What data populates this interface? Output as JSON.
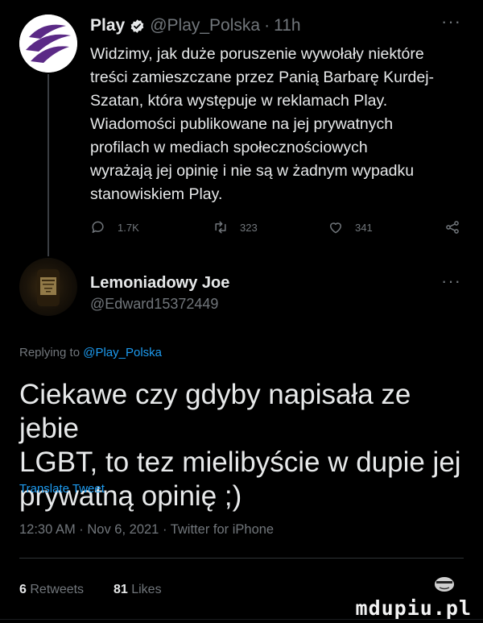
{
  "tweet1": {
    "author_name": "Play",
    "handle": "@Play_Polska",
    "separator": "·",
    "time_ago": "11h",
    "more": "···",
    "text_lines": [
      "Widzimy, jak duże poruszenie wywołały niektóre",
      "treści zamieszczane przez Panią Barbarę Kurdej-",
      "Szatan, która występuje w reklamach Play.",
      "Wiadomości publikowane na jej prywatnych",
      "profilach w mediach społecznościowych",
      "wyrażają jej opinię i nie są w żadnym wypadku",
      "stanowiskiem Play."
    ],
    "replies": "1.7K",
    "retweets": "323",
    "likes": "341",
    "icons": {
      "avatar": "play-logo-icon",
      "verified": "verified-badge-icon",
      "reply": "reply-icon",
      "retweet": "retweet-icon",
      "like": "heart-icon",
      "share": "share-icon"
    },
    "colors": {
      "brand_purple": "#5b2a86",
      "verified_blue": "#1d9bf0"
    }
  },
  "tweet2": {
    "author_name": "Lemoniadowy Joe",
    "handle": "@Edward15372449",
    "more": "···",
    "replying_prefix": "Replying to",
    "replying_to": "@Play_Polska",
    "text_lines": [
      "Ciekawe czy gdyby napisała ze jebie",
      "LGBT, to tez mielibyście w dupie jej",
      "prywatną opinię ;)"
    ],
    "translate": "Translate Tweet",
    "meta": "12:30 AM · Nov 6, 2021 · Twitter for iPhone",
    "retweets_count": "6",
    "retweets_label": "Retweets",
    "likes_count": "81",
    "likes_label": "Likes"
  },
  "watermark": "mdupiu.pl",
  "theme": {
    "background": "#000000",
    "text": "#e7e9ea",
    "muted": "#71767b",
    "link": "#1d9bf0"
  }
}
